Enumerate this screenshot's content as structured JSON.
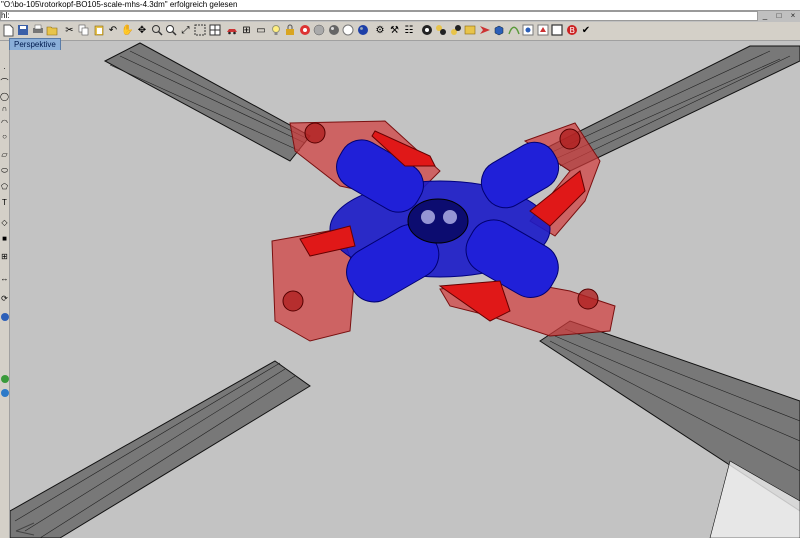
{
  "command_history": "\"O:\\bo-105\\rotorkopf-BO105-scale-mhs-4.3dm\" erfolgreich gelesen",
  "command_prompt": "hl:",
  "window_buttons": {
    "minimize": "_",
    "maximize": "□",
    "close": "×"
  },
  "viewport": {
    "title": "Perspektive"
  },
  "toolbar_icons": [
    "new-file-icon",
    "save-icon",
    "print-icon",
    "open-icon",
    "cut-icon",
    "copy-icon",
    "paste-icon",
    "undo-icon",
    "pan-hand-icon",
    "move-view-icon",
    "zoom-icon",
    "zoom-window-icon",
    "zoom-extents-icon",
    "zoom-selected-icon",
    "four-viewports-icon",
    "car-icon",
    "grid-icon",
    "hide-icon",
    "light-bulb-icon",
    "lock-icon",
    "render-icon",
    "shaded-sphere-icon",
    "rendered-sphere-icon",
    "ghost-sphere-icon",
    "blue-sphere-icon",
    "hidden-icon",
    "tools-icon",
    "properties-icon",
    "snap-icon",
    "color-balls-icon",
    "paint-bucket-icon",
    "render-preview-icon",
    "arrow-icon",
    "cube-icon",
    "curve-icon",
    "plugin-icon",
    "gear-icon",
    "document-icon",
    "circle-icon",
    "check-icon"
  ],
  "left_toolbar_icons": [
    "point-icon",
    "line-icon",
    "polyline-icon",
    "curve-icon",
    "arc-icon",
    "circle-icon",
    "rectangle-icon",
    "ellipse-icon",
    "polygon-icon",
    "text-icon",
    "surface-icon",
    "solid-icon",
    "mesh-icon",
    "dimension-icon",
    "transform-icon",
    "help-icon",
    "globe-icon",
    "earth-icon"
  ],
  "axis_label": "z"
}
